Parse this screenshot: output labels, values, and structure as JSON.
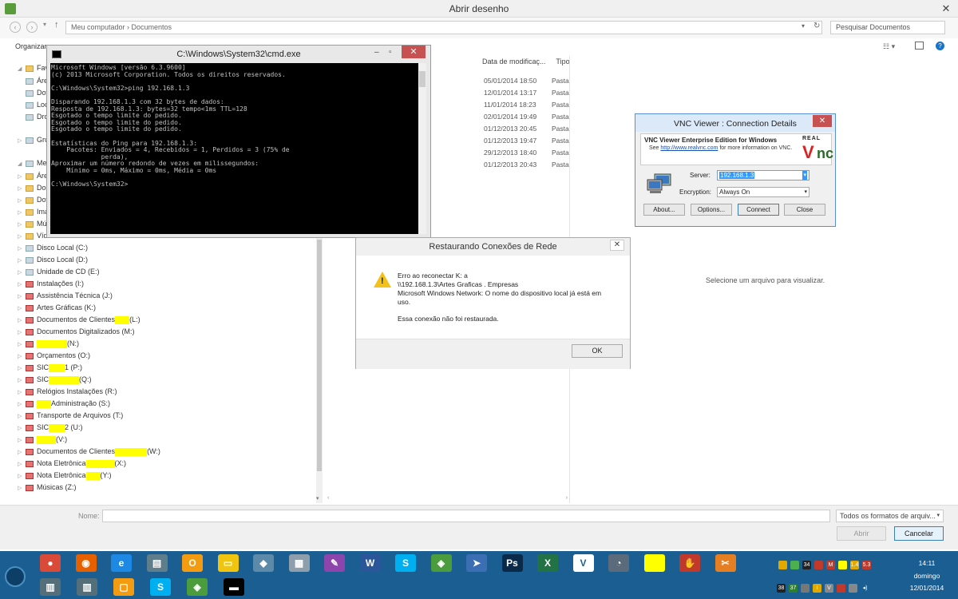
{
  "dialog": {
    "title": "Abrir desenho",
    "close_glyph": "✕",
    "address": "Meu computador  ›  Documentos",
    "search_placeholder": "Pesquisar Documentos",
    "organize": "Organizar"
  },
  "tree": {
    "favorites": "Favor",
    "fav_items": [
      "Áre",
      "Dov",
      "Loc",
      "Dro"
    ],
    "group": "Grupo",
    "computer": "Meu",
    "folders": [
      "Áre",
      "Doc",
      "Dov",
      "Ima",
      "Mú",
      "Víd"
    ],
    "drives": [
      {
        "pre": "Disco Local (C:)",
        "post": "",
        "type": "drv"
      },
      {
        "pre": "Disco Local (D:)",
        "post": "",
        "type": "drv"
      },
      {
        "pre": "Unidade de CD (E:)",
        "post": "",
        "type": "drv"
      },
      {
        "pre": "Instalações (I:)",
        "post": "",
        "type": "net"
      },
      {
        "pre": "Assistência Técnica (J:)",
        "post": "",
        "type": "net"
      },
      {
        "pre": "Artes Gráficas (K:)",
        "post": "",
        "type": "net"
      },
      {
        "pre": "Documentos de Clientes",
        "post": "(L:)",
        "type": "net",
        "hl": 18
      },
      {
        "pre": "Documentos Digitalizados (M:)",
        "post": "",
        "type": "net"
      },
      {
        "pre": "",
        "post": "(N:)",
        "type": "net",
        "hl": 38
      },
      {
        "pre": "Orçamentos (O:)",
        "post": "",
        "type": "net"
      },
      {
        "pre": "SIC",
        "post": "1 (P:)",
        "type": "net",
        "hl": 20
      },
      {
        "pre": "SIC",
        "post": "(Q:)",
        "type": "net",
        "hl": 38
      },
      {
        "pre": "Relógios Instalações (R:)",
        "post": "",
        "type": "net"
      },
      {
        "pre": "",
        "post": "Administração (S:)",
        "type": "net",
        "hl": 18
      },
      {
        "pre": "Transporte de Arquivos (T:)",
        "post": "",
        "type": "net"
      },
      {
        "pre": "SIC",
        "post": "2 (U:)",
        "type": "net",
        "hl": 20
      },
      {
        "pre": "",
        "post": "(V:)",
        "type": "net",
        "hl": 24
      },
      {
        "pre": "Documentos de Clientes",
        "post": "(W:)",
        "type": "net",
        "hl": 40
      },
      {
        "pre": "Nota Eletrônica",
        "post": "(X:)",
        "type": "net",
        "hl": 36
      },
      {
        "pre": "Nota Eletrônica",
        "post": "(Y:)",
        "type": "net",
        "hl": 18
      },
      {
        "pre": "Músicas (Z:)",
        "post": "",
        "type": "net"
      }
    ]
  },
  "files": {
    "col_date": "Data de modificaç...",
    "col_type": "Tipo",
    "rows": [
      {
        "date": "05/01/2014 18:50",
        "type": "Pasta"
      },
      {
        "date": "12/01/2014 13:17",
        "type": "Pasta"
      },
      {
        "date": "11/01/2014 18:23",
        "type": "Pasta"
      },
      {
        "date": "02/01/2014 19:49",
        "type": "Pasta"
      },
      {
        "date": "01/12/2013 20:45",
        "type": "Pasta"
      },
      {
        "date": "01/12/2013 19:47",
        "type": "Pasta"
      },
      {
        "date": "29/12/2013 18:40",
        "type": "Pasta"
      },
      {
        "date": "01/12/2013 20:43",
        "type": "Pasta"
      }
    ],
    "preview_text": "Selecione um arquivo para visualizar."
  },
  "footer": {
    "name_label": "Nome:",
    "file_type": "Todos os formatos de arquiv...",
    "open": "Abrir",
    "cancel": "Cancelar"
  },
  "cmd": {
    "title": "C:\\Windows\\System32\\cmd.exe",
    "output": "Microsoft Windows [versão 6.3.9600]\n(c) 2013 Microsoft Corporation. Todos os direitos reservados.\n\nC:\\Windows\\System32>ping 192.168.1.3\n\nDisparando 192.168.1.3 com 32 bytes de dados:\nResposta de 192.168.1.3: bytes=32 tempo<1ms TTL=128\nEsgotado o tempo limite do pedido.\nEsgotado o tempo limite do pedido.\nEsgotado o tempo limite do pedido.\n\nEstatísticas do Ping para 192.168.1.3:\n    Pacotes: Enviados = 4, Recebidos = 1, Perdidos = 3 (75% de\n             perda),\nAproximar um número redondo de vezes em milissegundos:\n    Mínimo = 0ms, Máximo = 0ms, Média = 0ms\n\nC:\\Windows\\System32>"
  },
  "restore": {
    "title": "Restaurando Conexões de Rede",
    "line1": "Erro ao reconectar K: a",
    "line2": "\\\\192.168.1.3\\Artes Graficas . Empresas",
    "line3": "Microsoft Windows Network: O nome do dispositivo local já está em",
    "line4": "uso.",
    "line5": "Essa conexão não foi restaurada.",
    "ok": "OK"
  },
  "vnc": {
    "title": "VNC Viewer : Connection Details",
    "edition": "VNC Viewer Enterprise Edition for Windows",
    "see_pre": "See ",
    "link": "http://www.realvnc.com",
    "see_post": " for more information on VNC.",
    "logo_real": "REAL",
    "logo_v": "V",
    "logo_nc": "nc",
    "server_label": "Server:",
    "server_value": "192.168.1.3",
    "encryption_label": "Encryption:",
    "encryption_value": "Always On",
    "about": "About...",
    "options": "Options...",
    "connect": "Connect",
    "close": "Close"
  },
  "taskbar": {
    "apps": [
      {
        "name": "chrome-icon",
        "glyph": "●",
        "color": "#d94a38"
      },
      {
        "name": "firefox-icon",
        "glyph": "◉",
        "color": "#e66000"
      },
      {
        "name": "ie-icon",
        "glyph": "e",
        "color": "#1e88e5"
      },
      {
        "name": "files-icon",
        "glyph": "▤",
        "color": "#607d8b"
      },
      {
        "name": "outlook-icon",
        "glyph": "O",
        "color": "#f39c12"
      },
      {
        "name": "explorer-icon",
        "glyph": "▭",
        "color": "#f1c40f"
      },
      {
        "name": "notes-icon",
        "glyph": "◆",
        "color": "#5d8aa8"
      },
      {
        "name": "calculator-icon",
        "glyph": "▦",
        "color": "#8e9eab"
      },
      {
        "name": "paint-icon",
        "glyph": "✎",
        "color": "#8e44ad"
      },
      {
        "name": "word-icon",
        "glyph": "W",
        "color": "#2b579a"
      },
      {
        "name": "skype-icon",
        "glyph": "S",
        "color": "#00aff0"
      },
      {
        "name": "sketchup-icon",
        "glyph": "◈",
        "color": "#4a9c3c"
      },
      {
        "name": "send-icon",
        "glyph": "➤",
        "color": "#3c6eb4"
      },
      {
        "name": "photoshop-icon",
        "glyph": "Ps",
        "color": "#0b2a4a"
      },
      {
        "name": "excel-icon",
        "glyph": "X",
        "color": "#217346"
      },
      {
        "name": "vnc-icon",
        "glyph": "V",
        "color": "#ffffff"
      },
      {
        "name": "speedometer-icon",
        "glyph": "◔",
        "color": "#5b6b7b"
      },
      {
        "name": "redacted-app-icon",
        "glyph": "",
        "color": "#ffff00"
      },
      {
        "name": "glove-icon",
        "glyph": "✋",
        "color": "#c0392b"
      },
      {
        "name": "tools-icon",
        "glyph": "✂",
        "color": "#e67e22"
      }
    ],
    "apps2": [
      {
        "name": "network-icon",
        "glyph": "▥",
        "color": "#546e7a"
      },
      {
        "name": "network-2-icon",
        "glyph": "▥",
        "color": "#546e7a"
      },
      {
        "name": "outlook-2-icon",
        "glyph": "▢",
        "color": "#f39c12"
      },
      {
        "name": "skype-2-icon",
        "glyph": "S",
        "color": "#00aff0"
      },
      {
        "name": "sketchup-2-icon",
        "glyph": "◈",
        "color": "#4a9c3c"
      },
      {
        "name": "cmd-taskbar-icon",
        "glyph": "▬",
        "color": "#000000"
      }
    ],
    "tray_top": [
      "",
      "",
      "34",
      "",
      "M",
      "",
      "1.4",
      "5.3"
    ],
    "tray_bottom": [
      "38",
      "37",
      "",
      "i",
      "V",
      "",
      "",
      "◂)"
    ],
    "time": "14:11",
    "day": "domingo",
    "date": "12/01/2014"
  }
}
